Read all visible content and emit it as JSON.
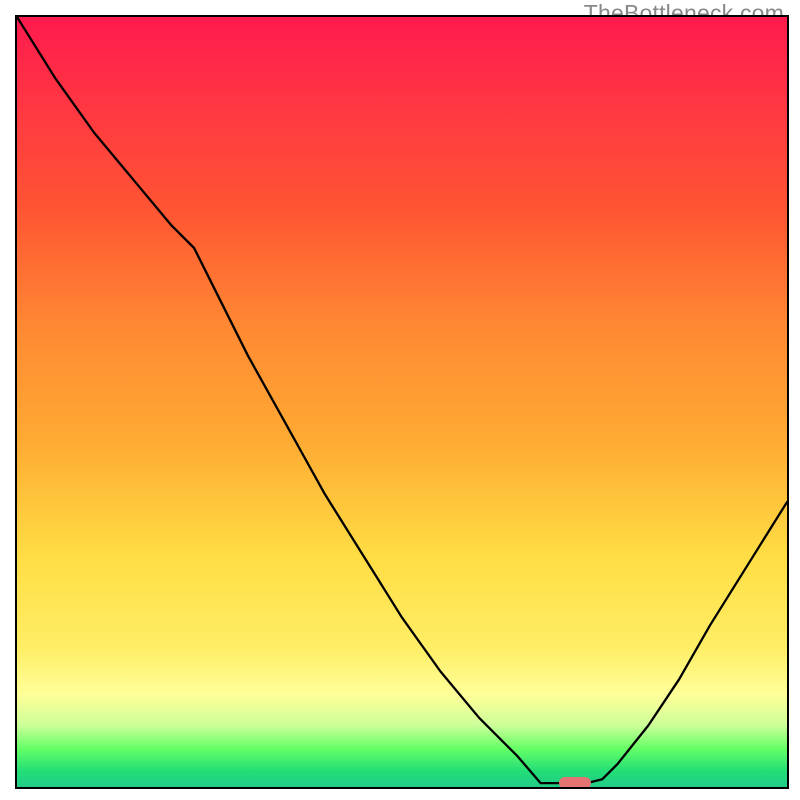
{
  "watermark": "TheBottleneck.com",
  "chart_data": {
    "type": "line",
    "title": "",
    "xlabel": "",
    "ylabel": "",
    "x": [
      0.0,
      0.05,
      0.1,
      0.15,
      0.2,
      0.23,
      0.25,
      0.3,
      0.35,
      0.4,
      0.45,
      0.5,
      0.55,
      0.6,
      0.65,
      0.68,
      0.74,
      0.76,
      0.78,
      0.82,
      0.86,
      0.9,
      0.95,
      1.0
    ],
    "y": [
      1.0,
      0.92,
      0.85,
      0.79,
      0.73,
      0.7,
      0.66,
      0.56,
      0.47,
      0.38,
      0.3,
      0.22,
      0.15,
      0.09,
      0.04,
      0.005,
      0.005,
      0.01,
      0.03,
      0.08,
      0.14,
      0.21,
      0.29,
      0.37
    ],
    "background_gradient": [
      "#ff1a4d",
      "#ff5533",
      "#ffaa33",
      "#ffee66",
      "#ffff99",
      "#22dd77"
    ],
    "marker": {
      "x": 0.725,
      "y": 0.005,
      "color": "#e57373"
    }
  }
}
